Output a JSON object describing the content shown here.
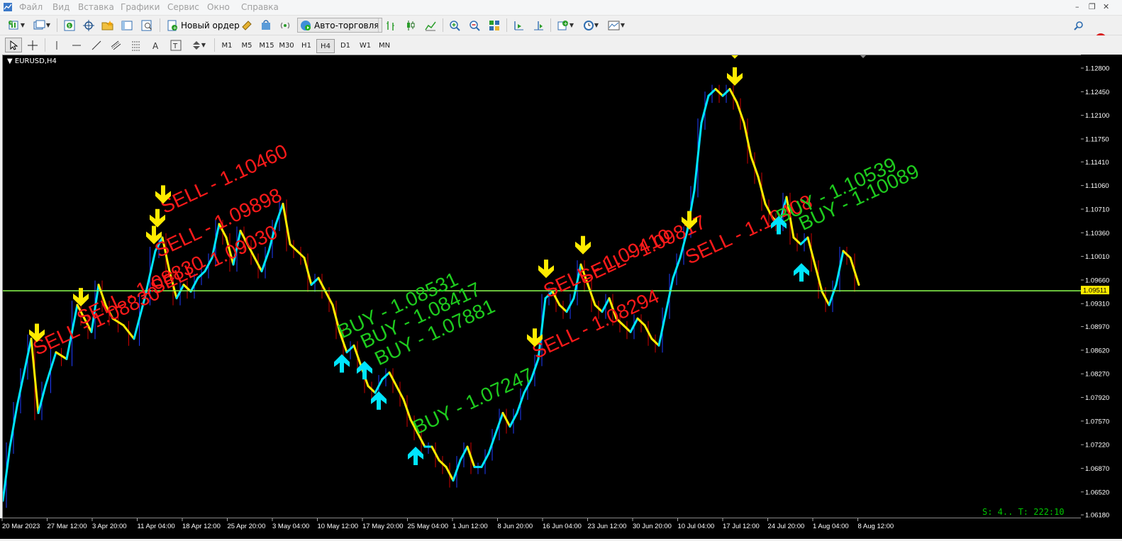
{
  "menu": [
    "Файл",
    "Вид",
    "Вставка",
    "Графики",
    "Сервис",
    "Окно",
    "Справка"
  ],
  "toolbar": {
    "new_order": "Новый ордер",
    "auto_trading": "Авто-торговля",
    "notifications_count": "1"
  },
  "timeframes": [
    "M1",
    "M5",
    "M15",
    "M30",
    "H1",
    "H4",
    "D1",
    "W1",
    "MN"
  ],
  "active_timeframe": "H4",
  "chart": {
    "title": "EURUSD,H4",
    "current_price": "1.09511",
    "status": "S: 4.. T: 222:10",
    "colors": {
      "background": "#000000",
      "bull": "#00e5ff",
      "bear": "#ffeb00",
      "wick_down": "#cc0000",
      "wick_up": "#1e3cff",
      "bid_line": "#8cff50",
      "sell": "#ff1a1a",
      "buy": "#1ecc1e"
    }
  },
  "chart_data": {
    "type": "line",
    "symbol": "EURUSD",
    "timeframe": "H4",
    "price_levels": [
      "1.12800",
      "1.12450",
      "1.12100",
      "1.11750",
      "1.11410",
      "1.11060",
      "1.10710",
      "1.10360",
      "1.10010",
      "1.09660",
      "1.09310",
      "1.08970",
      "1.08620",
      "1.08270",
      "1.07920",
      "1.07570",
      "1.07220",
      "1.06870",
      "1.06520",
      "1.06180"
    ],
    "time_labels": [
      "20 Mar 2023",
      "27 Mar 12:00",
      "3 Apr 20:00",
      "11 Apr 04:00",
      "18 Apr 12:00",
      "25 Apr 20:00",
      "3 May 04:00",
      "10 May 12:00",
      "17 May 20:00",
      "25 May 04:00",
      "1 Jun 12:00",
      "8 Jun 20:00",
      "16 Jun 04:00",
      "23 Jun 12:00",
      "30 Jun 20:00",
      "10 Jul 04:00",
      "17 Jul 12:00",
      "24 Jul 20:00",
      "1 Aug 04:00",
      "8 Aug 12:00"
    ],
    "ylim": [
      1.0615,
      1.13
    ],
    "x_range": [
      0,
      1207
    ],
    "series": [
      {
        "x": [
          0,
          10,
          20,
          30,
          40,
          50,
          60,
          75,
          90,
          105,
          115,
          125,
          135,
          145,
          155,
          170,
          185,
          200,
          215,
          225,
          235,
          245,
          255,
          265,
          275,
          285,
          295,
          305,
          315,
          325,
          335,
          345,
          355,
          365,
          375,
          385,
          395,
          405,
          415,
          425,
          435,
          445,
          455,
          465,
          475,
          485,
          495,
          505,
          515,
          525,
          535,
          545,
          555,
          565,
          575,
          585,
          595,
          605,
          615,
          625,
          635,
          645,
          655,
          665,
          675,
          685,
          695,
          705,
          715,
          725,
          735,
          745,
          755,
          765,
          775,
          785,
          795,
          805,
          815,
          825,
          835,
          845,
          855,
          865,
          875,
          885,
          895,
          905,
          915,
          925,
          935,
          945,
          955,
          965,
          975,
          985,
          995,
          1005,
          1015,
          1025,
          1035,
          1045,
          1055,
          1065,
          1075,
          1085,
          1095,
          1105,
          1115,
          1125,
          1135,
          1145,
          1155,
          1165,
          1175,
          1185,
          1195,
          1207
        ],
        "y": [
          1.064,
          1.072,
          1.078,
          1.083,
          1.088,
          1.077,
          1.081,
          1.086,
          1.085,
          1.093,
          1.091,
          1.089,
          1.096,
          1.093,
          1.091,
          1.09,
          1.088,
          1.094,
          1.101,
          1.103,
          1.098,
          1.094,
          1.096,
          1.095,
          1.097,
          1.098,
          1.1,
          1.105,
          1.103,
          1.099,
          1.104,
          1.102,
          1.1,
          1.098,
          1.101,
          1.105,
          1.108,
          1.102,
          1.101,
          1.1,
          1.096,
          1.097,
          1.095,
          1.093,
          1.089,
          1.086,
          1.087,
          1.084,
          1.081,
          1.08,
          1.082,
          1.083,
          1.081,
          1.079,
          1.076,
          1.074,
          1.072,
          1.072,
          1.07,
          1.069,
          1.067,
          1.07,
          1.072,
          1.069,
          1.069,
          1.071,
          1.074,
          1.077,
          1.075,
          1.077,
          1.08,
          1.082,
          1.085,
          1.094,
          1.095,
          1.093,
          1.092,
          1.094,
          1.099,
          1.096,
          1.093,
          1.092,
          1.094,
          1.091,
          1.09,
          1.089,
          1.091,
          1.09,
          1.088,
          1.087,
          1.092,
          1.097,
          1.1,
          1.104,
          1.11,
          1.12,
          1.124,
          1.125,
          1.124,
          1.125,
          1.123,
          1.12,
          1.115,
          1.112,
          1.108,
          1.106,
          1.105,
          1.109,
          1.103,
          1.102,
          1.103,
          1.099,
          1.095,
          1.093,
          1.096,
          1.101,
          1.1,
          1.096
        ]
      }
    ],
    "signals": [
      {
        "type": "sell",
        "label": "SELL - 1.08830",
        "x": 48,
        "arrow_y": 1.0875
      },
      {
        "type": "sell",
        "label": "SELL - 1.08830",
        "x": 110,
        "arrow_y": 1.0928
      },
      {
        "type": "sell",
        "label": "SELL - 1.10460",
        "x": 226,
        "arrow_y": 1.108
      },
      {
        "type": "sell",
        "label": "SELL - 1.09898",
        "x": 218,
        "arrow_y": 1.1045
      },
      {
        "type": "sell",
        "label": "SELL - 1.09030",
        "x": 213,
        "arrow_y": 1.102
      },
      {
        "type": "buy",
        "label": "BUY - 1.08531",
        "x": 478,
        "arrow_y": 1.0855
      },
      {
        "type": "buy",
        "label": "BUY - 1.08417",
        "x": 510,
        "arrow_y": 1.0845
      },
      {
        "type": "buy",
        "label": "BUY - 1.07881",
        "x": 530,
        "arrow_y": 1.08
      },
      {
        "type": "buy",
        "label": "BUY - 1.07247",
        "x": 582,
        "arrow_y": 1.0718
      },
      {
        "type": "sell",
        "label": "SELL - 1.08294",
        "x": 750,
        "arrow_y": 1.0868
      },
      {
        "type": "sell",
        "label": "SELL - 1.09410",
        "x": 766,
        "arrow_y": 1.097
      },
      {
        "type": "sell",
        "label": "SELL - 1.09817",
        "x": 818,
        "arrow_y": 1.1005
      },
      {
        "type": "sell",
        "label": "SELL - 1.10408",
        "x": 968,
        "arrow_y": 1.1042
      },
      {
        "type": "sell",
        "label": "SELL",
        "x": 1032,
        "arrow_y": 1.1295
      },
      {
        "type": "sell",
        "label": "SELL",
        "x": 1032,
        "arrow_y": 1.1255
      },
      {
        "type": "buy",
        "label": "BUY - 1.10539",
        "x": 1094,
        "arrow_y": 1.106
      },
      {
        "type": "buy",
        "label": "BUY - 1.10089",
        "x": 1126,
        "arrow_y": 1.099
      }
    ],
    "text_labels": [
      {
        "text": "SELL - 1.08830",
        "color": "sell",
        "x": 48,
        "y": 1.0855,
        "angle": -25
      },
      {
        "text": "SELL - 1.08830",
        "color": "sell",
        "x": 110,
        "y": 1.09,
        "angle": -25
      },
      {
        "text": "SELL - 1.10460",
        "color": "sell",
        "x": 228,
        "y": 1.1065,
        "angle": -25
      },
      {
        "text": "SELL - 1.09898",
        "color": "sell",
        "x": 220,
        "y": 1.1,
        "angle": -25
      },
      {
        "text": "SELL - 1.09030",
        "color": "sell",
        "x": 214,
        "y": 1.0945,
        "angle": -25
      },
      {
        "text": "BUY - 1.08531",
        "color": "buy",
        "x": 478,
        "y": 1.088,
        "angle": -25
      },
      {
        "text": "BUY - 1.08417",
        "color": "buy",
        "x": 510,
        "y": 1.0865,
        "angle": -25
      },
      {
        "text": "BUY - 1.07881",
        "color": "buy",
        "x": 530,
        "y": 1.084,
        "angle": -25
      },
      {
        "text": "BUY - 1.07247",
        "color": "buy",
        "x": 584,
        "y": 1.0738,
        "angle": -25
      },
      {
        "text": "SELL - 1.08294",
        "color": "sell",
        "x": 752,
        "y": 1.085,
        "angle": -25
      },
      {
        "text": "SELL - 1.09410",
        "color": "sell",
        "x": 768,
        "y": 1.094,
        "angle": -25
      },
      {
        "text": "SELL - 1.09817",
        "color": "sell",
        "x": 818,
        "y": 1.096,
        "angle": -25
      },
      {
        "text": "SELL - 1.10408",
        "color": "sell",
        "x": 968,
        "y": 1.099,
        "angle": -25
      },
      {
        "text": "BUY - 1.10539",
        "color": "buy",
        "x": 1096,
        "y": 1.105,
        "angle": -25
      },
      {
        "text": "BUY - 1.10089",
        "color": "buy",
        "x": 1128,
        "y": 1.104,
        "angle": -25
      }
    ]
  }
}
